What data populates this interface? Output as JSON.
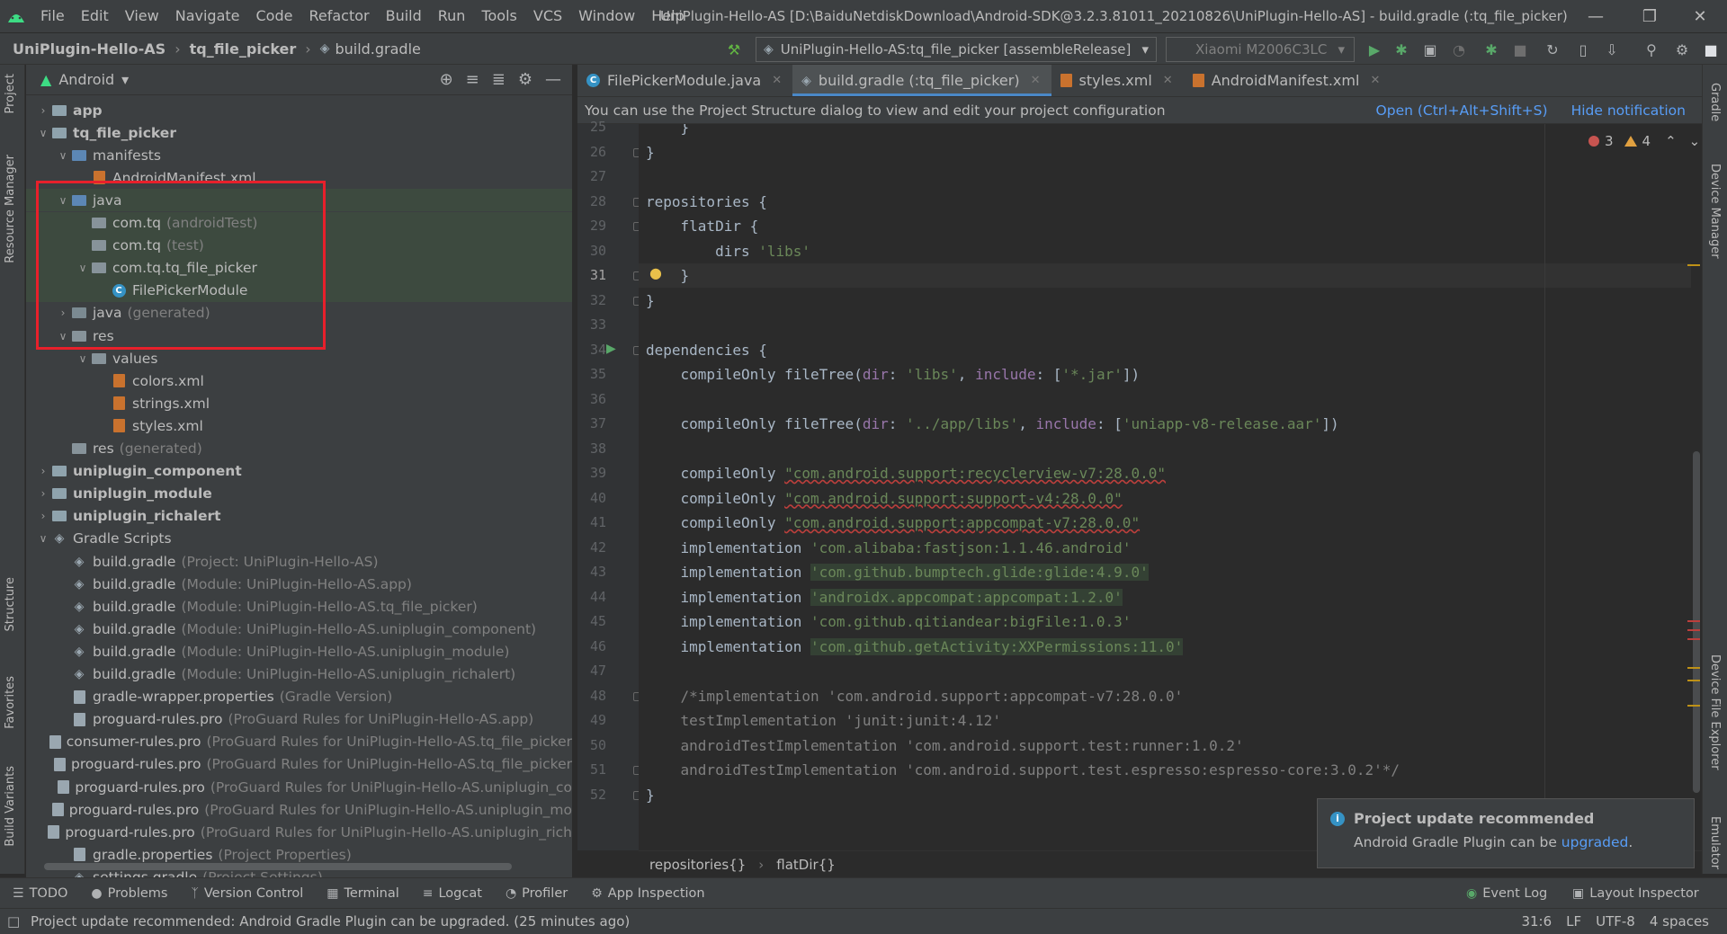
{
  "menubar": {
    "items": [
      "File",
      "Edit",
      "View",
      "Navigate",
      "Code",
      "Refactor",
      "Build",
      "Run",
      "Tools",
      "VCS",
      "Window",
      "Help"
    ],
    "window_title": "UniPlugin-Hello-AS [D:\\BaiduNetdiskDownload\\Android-SDK@3.2.3.81011_20210826\\UniPlugin-Hello-AS] - build.gradle (:tq_file_picker)"
  },
  "navbar": {
    "crumbs": [
      "UniPlugin-Hello-AS",
      "tq_file_picker",
      "build.gradle"
    ],
    "run_config": "UniPlugin-Hello-AS:tq_file_picker [assembleRelease]",
    "device": "Xiaomi M2006C3LC"
  },
  "left_strip": [
    "Project",
    "Resource Manager",
    "Structure",
    "Favorites",
    "Build Variants"
  ],
  "right_strip": [
    "Gradle",
    "Device Manager",
    "Device File Explorer",
    "Emulator"
  ],
  "project": {
    "view": "Android",
    "tree": [
      {
        "label": "app",
        "sub": "",
        "depth": 0,
        "arrow": "right",
        "icon": "module",
        "bold": true
      },
      {
        "label": "tq_file_picker",
        "sub": "",
        "depth": 0,
        "arrow": "down",
        "icon": "module",
        "bold": true
      },
      {
        "label": "manifests",
        "sub": "",
        "depth": 1,
        "arrow": "down",
        "icon": "folder-blue",
        "bold": false
      },
      {
        "label": "AndroidManifest.xml",
        "sub": "",
        "depth": 2,
        "arrow": "",
        "icon": "xml",
        "bold": false
      },
      {
        "label": "java",
        "sub": "",
        "depth": 1,
        "arrow": "down",
        "icon": "folder-blue",
        "bold": false
      },
      {
        "label": "com.tq",
        "sub": "(androidTest)",
        "depth": 2,
        "arrow": "",
        "icon": "package",
        "bold": false
      },
      {
        "label": "com.tq",
        "sub": "(test)",
        "depth": 2,
        "arrow": "",
        "icon": "package",
        "bold": false
      },
      {
        "label": "com.tq.tq_file_picker",
        "sub": "",
        "depth": 2,
        "arrow": "down",
        "icon": "package",
        "bold": false
      },
      {
        "label": "FilePickerModule",
        "sub": "",
        "depth": 3,
        "arrow": "",
        "icon": "class",
        "bold": false
      },
      {
        "label": "java",
        "sub": "(generated)",
        "depth": 1,
        "arrow": "right",
        "icon": "folder-gen",
        "bold": false
      },
      {
        "label": "res",
        "sub": "",
        "depth": 1,
        "arrow": "down",
        "icon": "folder",
        "bold": false
      },
      {
        "label": "values",
        "sub": "",
        "depth": 2,
        "arrow": "down",
        "icon": "folder",
        "bold": false
      },
      {
        "label": "colors.xml",
        "sub": "",
        "depth": 3,
        "arrow": "",
        "icon": "xml",
        "bold": false
      },
      {
        "label": "strings.xml",
        "sub": "",
        "depth": 3,
        "arrow": "",
        "icon": "xml",
        "bold": false
      },
      {
        "label": "styles.xml",
        "sub": "",
        "depth": 3,
        "arrow": "",
        "icon": "xml",
        "bold": false
      },
      {
        "label": "res",
        "sub": "(generated)",
        "depth": 1,
        "arrow": "",
        "icon": "folder",
        "bold": false
      },
      {
        "label": "uniplugin_component",
        "sub": "",
        "depth": 0,
        "arrow": "right",
        "icon": "module",
        "bold": true
      },
      {
        "label": "uniplugin_module",
        "sub": "",
        "depth": 0,
        "arrow": "right",
        "icon": "module",
        "bold": true
      },
      {
        "label": "uniplugin_richalert",
        "sub": "",
        "depth": 0,
        "arrow": "right",
        "icon": "module",
        "bold": true
      },
      {
        "label": "Gradle Scripts",
        "sub": "",
        "depth": 0,
        "arrow": "down",
        "icon": "gradle",
        "bold": false
      },
      {
        "label": "build.gradle",
        "sub": "(Project: UniPlugin-Hello-AS)",
        "depth": 1,
        "arrow": "",
        "icon": "gradle",
        "bold": false
      },
      {
        "label": "build.gradle",
        "sub": "(Module: UniPlugin-Hello-AS.app)",
        "depth": 1,
        "arrow": "",
        "icon": "gradle",
        "bold": false
      },
      {
        "label": "build.gradle",
        "sub": "(Module: UniPlugin-Hello-AS.tq_file_picker)",
        "depth": 1,
        "arrow": "",
        "icon": "gradle",
        "bold": false
      },
      {
        "label": "build.gradle",
        "sub": "(Module: UniPlugin-Hello-AS.uniplugin_component)",
        "depth": 1,
        "arrow": "",
        "icon": "gradle",
        "bold": false
      },
      {
        "label": "build.gradle",
        "sub": "(Module: UniPlugin-Hello-AS.uniplugin_module)",
        "depth": 1,
        "arrow": "",
        "icon": "gradle",
        "bold": false
      },
      {
        "label": "build.gradle",
        "sub": "(Module: UniPlugin-Hello-AS.uniplugin_richalert)",
        "depth": 1,
        "arrow": "",
        "icon": "gradle",
        "bold": false
      },
      {
        "label": "gradle-wrapper.properties",
        "sub": "(Gradle Version)",
        "depth": 1,
        "arrow": "",
        "icon": "file",
        "bold": false
      },
      {
        "label": "proguard-rules.pro",
        "sub": "(ProGuard Rules for UniPlugin-Hello-AS.app)",
        "depth": 1,
        "arrow": "",
        "icon": "file",
        "bold": false
      },
      {
        "label": "consumer-rules.pro",
        "sub": "(ProGuard Rules for UniPlugin-Hello-AS.tq_file_picker",
        "depth": 1,
        "arrow": "",
        "icon": "file",
        "bold": false
      },
      {
        "label": "proguard-rules.pro",
        "sub": "(ProGuard Rules for UniPlugin-Hello-AS.tq_file_picker",
        "depth": 1,
        "arrow": "",
        "icon": "file",
        "bold": false
      },
      {
        "label": "proguard-rules.pro",
        "sub": "(ProGuard Rules for UniPlugin-Hello-AS.uniplugin_co",
        "depth": 1,
        "arrow": "",
        "icon": "file",
        "bold": false
      },
      {
        "label": "proguard-rules.pro",
        "sub": "(ProGuard Rules for UniPlugin-Hello-AS.uniplugin_mo",
        "depth": 1,
        "arrow": "",
        "icon": "file",
        "bold": false
      },
      {
        "label": "proguard-rules.pro",
        "sub": "(ProGuard Rules for UniPlugin-Hello-AS.uniplugin_rich",
        "depth": 1,
        "arrow": "",
        "icon": "file",
        "bold": false
      },
      {
        "label": "gradle.properties",
        "sub": "(Project Properties)",
        "depth": 1,
        "arrow": "",
        "icon": "file",
        "bold": false
      },
      {
        "label": "settings.gradle",
        "sub": "(Project Settings)",
        "depth": 1,
        "arrow": "",
        "icon": "gradle",
        "bold": false
      }
    ]
  },
  "tabs": [
    {
      "label": "FilePickerModule.java",
      "icon": "class",
      "active": false
    },
    {
      "label": "build.gradle (:tq_file_picker)",
      "icon": "gradle",
      "active": true
    },
    {
      "label": "styles.xml",
      "icon": "xml",
      "active": false
    },
    {
      "label": "AndroidManifest.xml",
      "icon": "xml",
      "active": false
    }
  ],
  "notification": {
    "text": "You can use the Project Structure dialog to view and edit your project configuration",
    "open_link": "Open (Ctrl+Alt+Shift+S)",
    "hide_link": "Hide notification"
  },
  "inspections": {
    "errors": "3",
    "warnings": "4"
  },
  "editor": {
    "current_line": "31",
    "lines": [
      {
        "n": "25",
        "segs": [
          {
            "t": "    }",
            "c": ""
          }
        ]
      },
      {
        "n": "26",
        "segs": [
          {
            "t": "}",
            "c": ""
          }
        ]
      },
      {
        "n": "27",
        "segs": []
      },
      {
        "n": "28",
        "segs": [
          {
            "t": "repositories {",
            "c": ""
          }
        ]
      },
      {
        "n": "29",
        "segs": [
          {
            "t": "    flatDir {",
            "c": ""
          }
        ]
      },
      {
        "n": "30",
        "segs": [
          {
            "t": "        dirs ",
            "c": ""
          },
          {
            "t": "'libs'",
            "c": "str"
          }
        ]
      },
      {
        "n": "31",
        "segs": [
          {
            "t": "    }",
            "c": ""
          }
        ]
      },
      {
        "n": "32",
        "segs": [
          {
            "t": "}",
            "c": ""
          }
        ]
      },
      {
        "n": "33",
        "segs": []
      },
      {
        "n": "34",
        "segs": [
          {
            "t": "dependencies {",
            "c": ""
          }
        ]
      },
      {
        "n": "35",
        "segs": [
          {
            "t": "    compileOnly fileTree(",
            "c": ""
          },
          {
            "t": "dir",
            "c": "named"
          },
          {
            "t": ": ",
            "c": ""
          },
          {
            "t": "'libs'",
            "c": "str"
          },
          {
            "t": ", ",
            "c": ""
          },
          {
            "t": "include",
            "c": "named"
          },
          {
            "t": ": [",
            "c": ""
          },
          {
            "t": "'*.jar'",
            "c": "str"
          },
          {
            "t": "])",
            "c": ""
          }
        ]
      },
      {
        "n": "36",
        "segs": []
      },
      {
        "n": "37",
        "segs": [
          {
            "t": "    compileOnly fileTree(",
            "c": ""
          },
          {
            "t": "dir",
            "c": "named"
          },
          {
            "t": ": ",
            "c": ""
          },
          {
            "t": "'../app/libs'",
            "c": "str"
          },
          {
            "t": ", ",
            "c": ""
          },
          {
            "t": "include",
            "c": "named"
          },
          {
            "t": ": [",
            "c": ""
          },
          {
            "t": "'uniapp-v8-release.aar'",
            "c": "str"
          },
          {
            "t": "])",
            "c": ""
          }
        ]
      },
      {
        "n": "38",
        "segs": []
      },
      {
        "n": "39",
        "segs": [
          {
            "t": "    compileOnly ",
            "c": ""
          },
          {
            "t": "\"com.android.support:recyclerview-v7:28.0.0\"",
            "c": "str err"
          }
        ]
      },
      {
        "n": "40",
        "segs": [
          {
            "t": "    compileOnly ",
            "c": ""
          },
          {
            "t": "\"com.android.support:support-v4:28.0.0\"",
            "c": "str err"
          }
        ]
      },
      {
        "n": "41",
        "segs": [
          {
            "t": "    compileOnly ",
            "c": ""
          },
          {
            "t": "\"com.android.support:appcompat-v7:28.0.0\"",
            "c": "str err"
          }
        ]
      },
      {
        "n": "42",
        "segs": [
          {
            "t": "    implementation ",
            "c": ""
          },
          {
            "t": "'com.alibaba:fastjson:1.1.46.android'",
            "c": "str"
          }
        ]
      },
      {
        "n": "43",
        "segs": [
          {
            "t": "    implementation ",
            "c": ""
          },
          {
            "t": "'com.github.bumptech.glide:glide:4.9.0'",
            "c": "str warn"
          }
        ]
      },
      {
        "n": "44",
        "segs": [
          {
            "t": "    implementation ",
            "c": ""
          },
          {
            "t": "'androidx.appcompat:appcompat:1.2.0'",
            "c": "str warn"
          }
        ]
      },
      {
        "n": "45",
        "segs": [
          {
            "t": "    implementation ",
            "c": ""
          },
          {
            "t": "'com.github.qitiandear:bigFile:1.0.3'",
            "c": "str"
          }
        ]
      },
      {
        "n": "46",
        "segs": [
          {
            "t": "    implementation ",
            "c": ""
          },
          {
            "t": "'com.github.getActivity:XXPermissions:11.0'",
            "c": "str warn"
          }
        ]
      },
      {
        "n": "47",
        "segs": []
      },
      {
        "n": "48",
        "segs": [
          {
            "t": "    /*implementation 'com.android.support:appcompat-v7:28.0.0'",
            "c": "cm"
          }
        ]
      },
      {
        "n": "49",
        "segs": [
          {
            "t": "    testImplementation 'junit:junit:4.12'",
            "c": "cm"
          }
        ]
      },
      {
        "n": "50",
        "segs": [
          {
            "t": "    androidTestImplementation 'com.android.support.test:runner:1.0.2'",
            "c": "cm"
          }
        ]
      },
      {
        "n": "51",
        "segs": [
          {
            "t": "    androidTestImplementation 'com.android.support.test.espresso:espresso-core:3.0.2'*/",
            "c": "cm"
          }
        ]
      },
      {
        "n": "52",
        "segs": [
          {
            "t": "}",
            "c": ""
          }
        ]
      }
    ]
  },
  "code_breadcrumb": [
    "repositories{}",
    "flatDir{}"
  ],
  "popup": {
    "title": "Project update recommended",
    "body_prefix": "Android Gradle Plugin can be ",
    "body_link": "upgraded",
    "body_suffix": "."
  },
  "bottom_tools": [
    "TODO",
    "Problems",
    "Version Control",
    "Terminal",
    "Logcat",
    "Profiler",
    "App Inspection"
  ],
  "bottom_tools_right": [
    "Event Log",
    "Layout Inspector"
  ],
  "status": {
    "message": "Project update recommended: Android Gradle Plugin can be upgraded. (25 minutes ago)",
    "position": "31:6",
    "line_sep": "LF",
    "encoding": "UTF-8",
    "indent": "4 spaces"
  },
  "colors": {
    "accent": "#4a88c7",
    "highlight_box": "#e8202b",
    "link": "#589df6"
  }
}
